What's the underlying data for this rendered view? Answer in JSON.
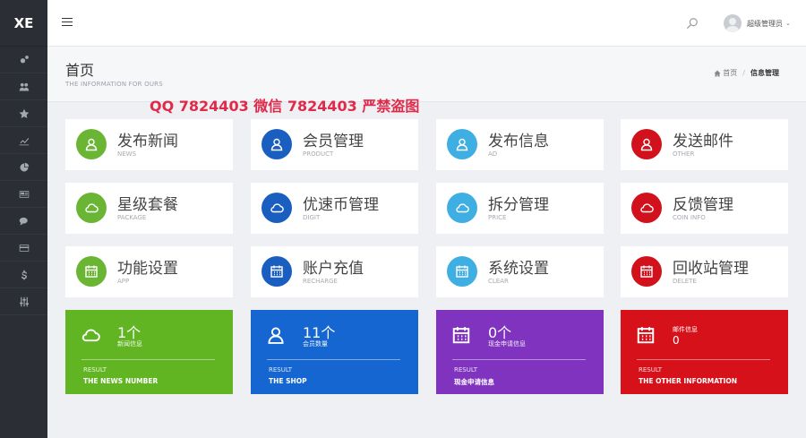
{
  "app": {
    "logo": "XE"
  },
  "sidebar": {
    "items": [
      {
        "icon": "gears-icon"
      },
      {
        "icon": "users-icon"
      },
      {
        "icon": "star-icon"
      },
      {
        "icon": "line-chart-icon"
      },
      {
        "icon": "pie-chart-icon"
      },
      {
        "icon": "newspaper-icon"
      },
      {
        "icon": "comments-icon"
      },
      {
        "icon": "credit-card-icon"
      },
      {
        "icon": "dollar-icon"
      },
      {
        "icon": "sliders-icon"
      }
    ]
  },
  "topbar": {
    "username": "超级管理员"
  },
  "header": {
    "title": "首页",
    "subtitle": "THE INFORMATION FOR OURS",
    "watermark": "QQ 7824403  微信 7824403 严禁盗图",
    "breadcrumb": {
      "home": "首页",
      "sep": "/",
      "current": "信息管理"
    }
  },
  "cards": [
    {
      "title": "发布新闻",
      "sub": "NEWS",
      "color": "#6bb534",
      "icon": "user"
    },
    {
      "title": "会员管理",
      "sub": "PRODUCT",
      "color": "#1a5fbf",
      "icon": "user"
    },
    {
      "title": "发布信息",
      "sub": "AD",
      "color": "#3eaee3",
      "icon": "user"
    },
    {
      "title": "发送邮件",
      "sub": "OTHER",
      "color": "#d1111c",
      "icon": "user"
    },
    {
      "title": "星级套餐",
      "sub": "PACKAGE",
      "color": "#6bb534",
      "icon": "cloud"
    },
    {
      "title": "优速币管理",
      "sub": "DIGIT",
      "color": "#1a5fbf",
      "icon": "cloud"
    },
    {
      "title": "拆分管理",
      "sub": "PRICE",
      "color": "#3eaee3",
      "icon": "cloud"
    },
    {
      "title": "反馈管理",
      "sub": "COIN INFO",
      "color": "#d1111c",
      "icon": "cloud"
    },
    {
      "title": "功能设置",
      "sub": "APP",
      "color": "#6bb534",
      "icon": "calendar"
    },
    {
      "title": "账户充值",
      "sub": "RECHARGE",
      "color": "#1a5fbf",
      "icon": "calendar"
    },
    {
      "title": "系统设置",
      "sub": "CLEAR",
      "color": "#3eaee3",
      "icon": "calendar"
    },
    {
      "title": "回收站管理",
      "sub": "DELETE",
      "color": "#d1111c",
      "icon": "calendar"
    }
  ],
  "panels": [
    {
      "value": "1个",
      "label": "新闻信息",
      "result": "RESULT",
      "foot": "THE NEWS NUMBER",
      "color": "#62b522",
      "icon": "cloud"
    },
    {
      "value": "11个",
      "label": "会员数量",
      "result": "RESULT",
      "foot": "THE SHOP",
      "color": "#1566d0",
      "icon": "user"
    },
    {
      "value": "0个",
      "label": "现金申请信息",
      "result": "RESULT",
      "foot": "现金申请信息",
      "color": "#7f33bf",
      "icon": "calendar"
    },
    {
      "value": "0",
      "label": "邮件信息",
      "result": "RESULT",
      "foot": "THE OTHER INFORMATION",
      "color": "#d7111a",
      "icon": "calendar"
    }
  ]
}
